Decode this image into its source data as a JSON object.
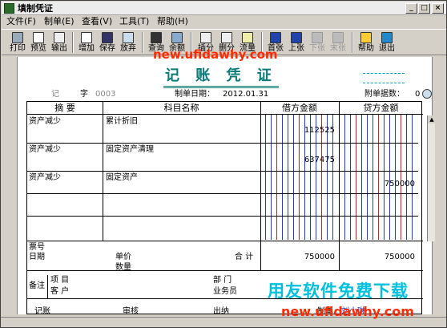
{
  "window": {
    "title": "填制凭证",
    "min": "_",
    "max": "□",
    "close": "×"
  },
  "menu": [
    "文件(F)",
    "制单(E)",
    "查看(V)",
    "工具(T)",
    "帮助(H)"
  ],
  "toolbar": [
    {
      "label": "打印",
      "icon": "printer-icon"
    },
    {
      "label": "预览",
      "icon": "preview-icon"
    },
    {
      "label": "输出",
      "icon": "export-icon"
    },
    {
      "label": "增加",
      "icon": "add-icon"
    },
    {
      "label": "保存",
      "icon": "save-icon"
    },
    {
      "label": "放弃",
      "icon": "undo-icon"
    },
    {
      "label": "查询",
      "icon": "binoculars-icon"
    },
    {
      "label": "余额",
      "icon": "balance-chart-icon"
    },
    {
      "label": "插分",
      "icon": "insert-row-icon"
    },
    {
      "label": "删分",
      "icon": "delete-row-icon"
    },
    {
      "label": "流量",
      "icon": "pencil-icon"
    },
    {
      "label": "首张",
      "icon": "first-icon"
    },
    {
      "label": "上张",
      "icon": "prev-icon"
    },
    {
      "label": "下张",
      "icon": "next-icon"
    },
    {
      "label": "末张",
      "icon": "last-icon"
    },
    {
      "label": "帮助",
      "icon": "help-icon"
    },
    {
      "label": "退出",
      "icon": "exit-icon"
    }
  ],
  "voucher": {
    "title": "记 账 凭 证",
    "type": "记",
    "zi": "字",
    "number": "0003",
    "date_label": "制单日期：",
    "date": "2012.01.31",
    "attach_label": "附单据数：",
    "attach_count": "0",
    "headers": {
      "summary": "摘 要",
      "account": "科目名称",
      "debit": "借方金额",
      "credit": "贷方金额"
    },
    "rows": [
      {
        "summary": "资产减少",
        "account": "累计折旧",
        "debit": "112525",
        "credit": ""
      },
      {
        "summary": "资产减少",
        "account": "固定资产清理",
        "debit": "637475",
        "credit": ""
      },
      {
        "summary": "资产减少",
        "account": "固定资产",
        "debit": "",
        "credit": "750000"
      },
      {
        "summary": "",
        "account": "",
        "debit": "",
        "credit": ""
      },
      {
        "summary": "",
        "account": "",
        "debit": "",
        "credit": ""
      }
    ],
    "footer": {
      "ticket_label": "票号",
      "date_label": "日期",
      "price_label": "单价",
      "qty_label": "数量",
      "total_label": "合 计",
      "total_debit": "750000",
      "total_credit": "750000",
      "remark_label": "备注",
      "project_label": "项 目",
      "customer_label": "客 户",
      "dept_label": "部 门",
      "staff_label": "业务员"
    },
    "status": {
      "bookkeep": "记账",
      "audit": "审核",
      "cashier": "出纳",
      "maker": "制单",
      "maker_name": "刘小琳"
    }
  },
  "watermarks": {
    "url1": "new.ufidawhy.com",
    "brand": "用友软件免费下载",
    "url2": "new.ufidawhy.com"
  },
  "colors": {
    "title": "#0a7a7a",
    "digit_blue": "#1b3fd6",
    "digit_red": "#d62020",
    "watermark_red": "#ff2a00",
    "watermark_cyan": "#00c0e0"
  }
}
